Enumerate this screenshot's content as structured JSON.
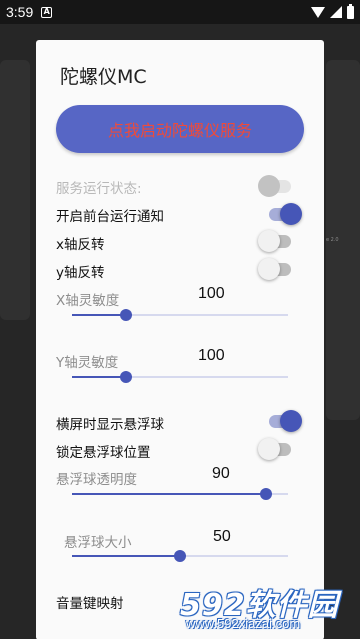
{
  "status_bar": {
    "time": "3:59",
    "notif_letter": "A"
  },
  "dialog": {
    "title": "陀螺仪MC",
    "start_button": "点我启动陀螺仪服务",
    "service_status_label": "服务运行状态:",
    "foreground_notify_label": "开启前台运行通知",
    "x_invert_label": "x轴反转",
    "y_invert_label": "y轴反转",
    "x_sensitivity": {
      "label": "X轴灵敏度",
      "value": "100",
      "level": 0.25
    },
    "y_sensitivity": {
      "label": "Y轴灵敏度",
      "value": "100",
      "level": 0.25
    },
    "landscape_float_label": "横屏时显示悬浮球",
    "lock_float_label": "锁定悬浮球位置",
    "float_opacity": {
      "label": "悬浮球透明度",
      "value": "90",
      "level": 0.9
    },
    "float_size": {
      "label": "悬浮球大小",
      "value": "50",
      "level": 0.5
    },
    "volume_key_label": "音量键映射"
  },
  "switches": {
    "service_status": "disabled-off",
    "foreground_notify": "on",
    "x_invert": "off",
    "y_invert": "off",
    "landscape_float": "on",
    "lock_float": "off"
  },
  "colors": {
    "accent": "#4656b7",
    "button_bg": "#5766c5",
    "button_text": "#ee4b3a"
  },
  "watermark": {
    "logo": "592软件园",
    "url": "www.592xiazai.com"
  },
  "background": {
    "badge_text": "e 2.0"
  }
}
